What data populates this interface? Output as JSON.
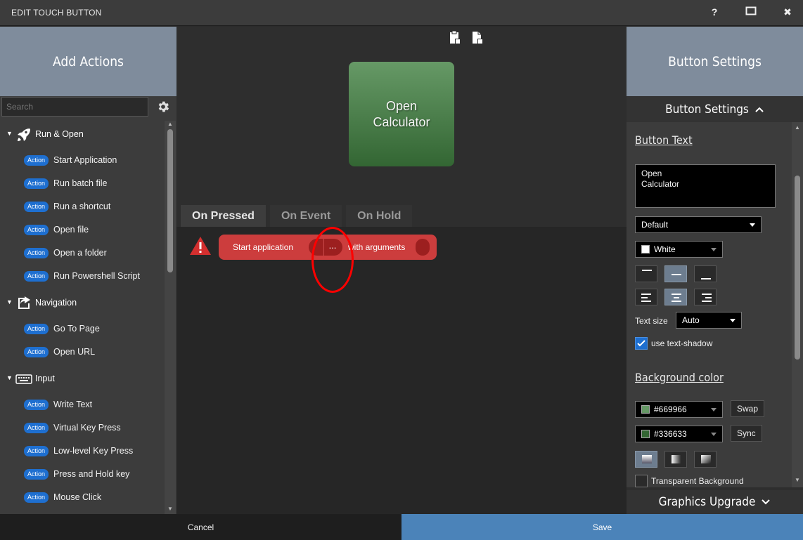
{
  "window": {
    "title": "EDIT TOUCH BUTTON",
    "help": "?",
    "maximize": "□",
    "close": "✖"
  },
  "left": {
    "header": "Add Actions",
    "search_placeholder": "Search",
    "categories": [
      {
        "label": "Run & Open",
        "icon": "rocket-icon",
        "actions": [
          "Start Application",
          "Run batch file",
          "Run a shortcut",
          "Open file",
          "Open a folder",
          "Run Powershell Script"
        ]
      },
      {
        "label": "Navigation",
        "icon": "navigate-icon",
        "actions": [
          "Go To Page",
          "Open URL"
        ]
      },
      {
        "label": "Input",
        "icon": "keyboard-icon",
        "actions": [
          "Write Text",
          "Virtual Key Press",
          "Low-level Key Press",
          "Press and Hold key",
          "Mouse Click"
        ]
      }
    ],
    "badge": "Action"
  },
  "center": {
    "preview_text": "Open\nCalculator",
    "tabs": [
      "On Pressed",
      "On Event",
      "On Hold"
    ],
    "active_tab": "On Pressed",
    "action_item": {
      "label": "Start application",
      "dots": "...",
      "args_label": "with arguments"
    }
  },
  "right": {
    "header": "Button Settings",
    "section_toggle": "Button Settings",
    "button_text_title": "Button Text",
    "button_text_value": "Open\nCalculator",
    "font_select": "Default",
    "color_select": "White",
    "text_size_label": "Text size",
    "text_size_value": "Auto",
    "text_shadow_label": "use text-shadow",
    "bg_title": "Background color",
    "color1": "#669966",
    "color2": "#336633",
    "swap": "Swap",
    "sync": "Sync",
    "transparent_label": "Transparent Background",
    "graphics_upgrade": "Graphics Upgrade"
  },
  "footer": {
    "cancel": "Cancel",
    "save": "Save"
  },
  "colors": {
    "accent": "#4b83b9",
    "header": "#7f8c9c",
    "badge": "#1e6fd0",
    "action_red": "#cc3d3d",
    "button_top": "#669966",
    "button_bottom": "#336633"
  }
}
